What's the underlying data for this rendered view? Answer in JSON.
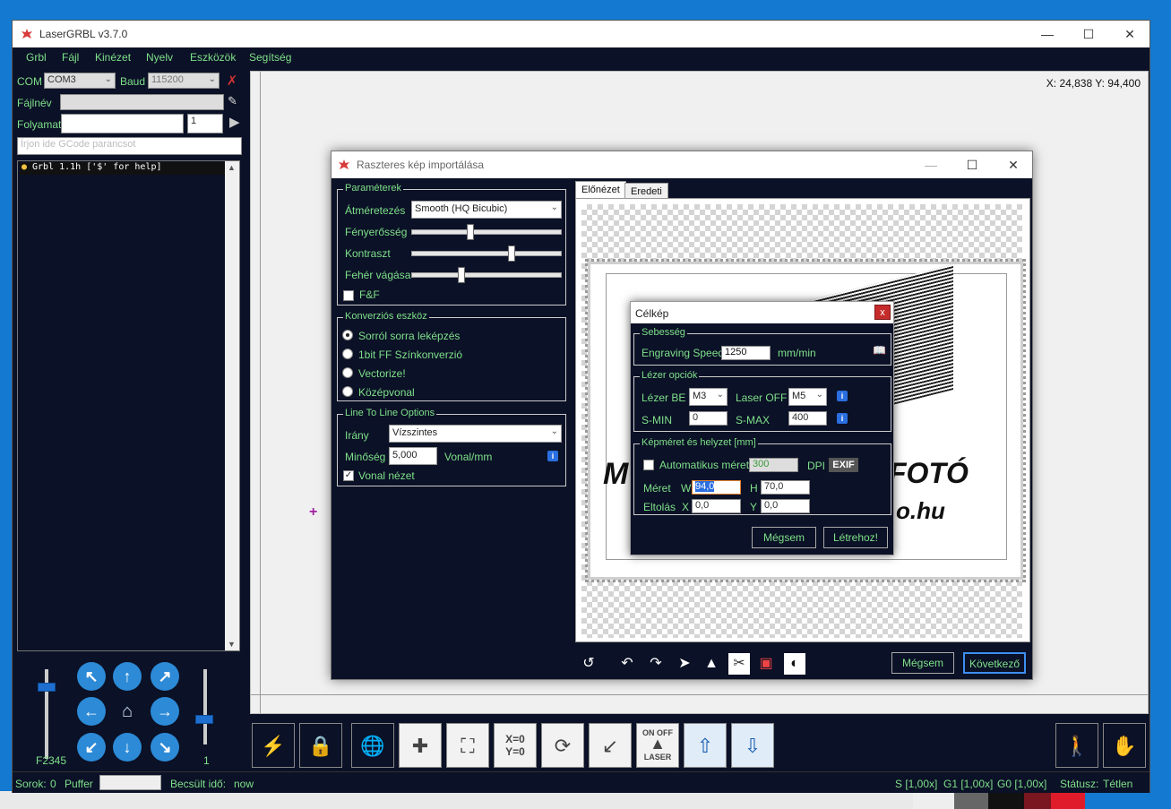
{
  "main_window": {
    "title": "LaserGRBL v3.7.0",
    "menu": [
      "Grbl",
      "Fájl",
      "Kinézet",
      "Nyelv",
      "Eszközök",
      "Segítség"
    ],
    "com_label": "COM",
    "com_value": "COM3",
    "baud_label": "Baud",
    "baud_value": "115200",
    "filename_label": "Fájlnév",
    "progress_label": "Folyamat",
    "progress_count": "1",
    "gcode_placeholder": "Írjon ide GCode parancsot",
    "console_line": "Grbl 1.1h ['$' for help]",
    "coords": "X: 24,838 Y: 94,400",
    "jog_left_label": "F2345",
    "jog_right_label": "1",
    "status": {
      "rows_label": "Sorok:",
      "rows_value": "0",
      "buffer_label": "Puffer",
      "estimate_label": "Becsült idő:",
      "estimate_value": "now",
      "s_override": "S [1,00x]",
      "g1_override": "G1 [1,00x]",
      "g0_override": "G0 [1,00x]",
      "status_label": "Státusz:",
      "status_value": "Tétlen"
    },
    "toolbar_icons": [
      "flash-icon",
      "lock-icon",
      "globe-icon",
      "center-icon",
      "frame-icon",
      "xy-zero-icon",
      "rotate-icon",
      "pen-icon",
      "laser-toggle-icon",
      "z-up-icon",
      "z-down-icon"
    ]
  },
  "raster_dialog": {
    "title": "Raszteres kép importálása",
    "params_legend": "Paraméterek",
    "resize_label": "Átméretezés",
    "resize_value": "Smooth (HQ Bicubic)",
    "brightness_label": "Fényerősség",
    "brightness_level": 0.38,
    "contrast_label": "Kontraszt",
    "contrast_level": 0.67,
    "white_clip_label": "Fehér vágása",
    "white_clip_level": 0.32,
    "ff_label": "F&F",
    "conversion_legend": "Konverziós eszköz",
    "conv_options": [
      "Sorról sorra leképzés",
      "1bit FF Színkonverzió",
      "Vectorize!",
      "Középvonal"
    ],
    "conv_selected": 0,
    "l2l_legend": "Line To Line Options",
    "direction_label": "Irány",
    "direction_value": "Vízszintes",
    "quality_label": "Minőség",
    "quality_value": "5,000",
    "quality_unit": "Vonal/mm",
    "line_preview_label": "Vonal nézet",
    "tab_preview": "Előnézet",
    "tab_original": "Eredeti",
    "cancel": "Mégsem",
    "next": "Következő"
  },
  "target_dialog": {
    "title": "Célkép",
    "close": "x",
    "speed_legend": "Sebesség",
    "engraving_speed_label": "Engraving Speed",
    "engraving_speed_value": "1250",
    "speed_unit": "mm/min",
    "laser_legend": "Lézer opciók",
    "laser_on_label": "Lézer BE",
    "laser_on_value": "M3",
    "laser_off_label": "Laser OFF",
    "laser_off_value": "M5",
    "smin_label": "S-MIN",
    "smin_value": "0",
    "smax_label": "S-MAX",
    "smax_value": "400",
    "size_legend": "Képméret és helyzet [mm]",
    "auto_size_label": "Automatikus méret",
    "dpi_value": "300",
    "dpi_label": "DPI",
    "exif_label": "EXIF",
    "size_label": "Méret",
    "w_label": "W",
    "w_value": "94,0",
    "h_label": "H",
    "h_value": "70,0",
    "offset_label": "Eltolás",
    "x_label": "X",
    "x_value": "0,0",
    "y_label": "Y",
    "y_value": "0,0",
    "cancel": "Mégsem",
    "create": "Létrehoz!"
  },
  "preview_image": {
    "text_left": "M",
    "text_right": "FOTÓ",
    "text_bottom": "o.hu"
  }
}
